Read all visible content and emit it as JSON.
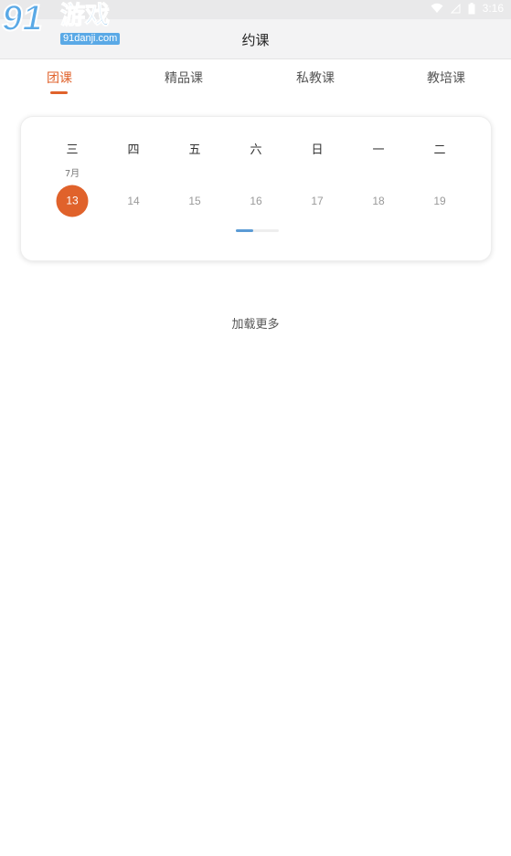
{
  "status_bar": {
    "time": "3:16",
    "icons": [
      "wifi-icon",
      "signal-icon",
      "battery-icon"
    ]
  },
  "watermark": {
    "number": "91",
    "name": "游戏",
    "domain": "91danji.com"
  },
  "header": {
    "title": "约课"
  },
  "tabs": [
    {
      "label": "团课",
      "active": true
    },
    {
      "label": "精品课",
      "active": false
    },
    {
      "label": "私教课",
      "active": false
    },
    {
      "label": "教培课",
      "active": false
    }
  ],
  "calendar": {
    "month_label": "7月",
    "weekdays": [
      "三",
      "四",
      "五",
      "六",
      "日",
      "一",
      "二"
    ],
    "days": [
      "13",
      "14",
      "15",
      "16",
      "17",
      "18",
      "19"
    ],
    "selected_day": "13",
    "pager_position": 0.4
  },
  "load_more": "加载更多",
  "colors": {
    "accent": "#e0622b",
    "pager_thumb": "#5b9bd5",
    "watermark_blue": "#5aa9e6"
  }
}
